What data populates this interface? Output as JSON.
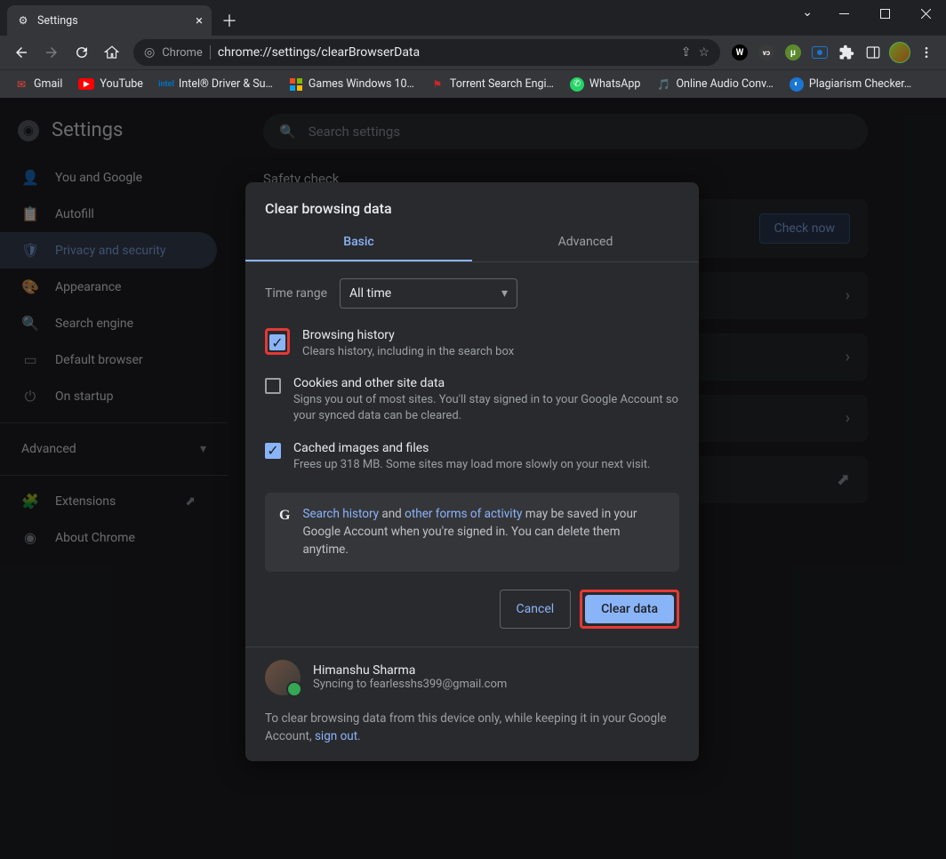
{
  "window": {
    "tab_title": "Settings"
  },
  "omnibox": {
    "label": "Chrome",
    "url": "chrome://settings/clearBrowserData"
  },
  "bookmarks": [
    {
      "label": "Gmail"
    },
    {
      "label": "YouTube"
    },
    {
      "label": "Intel® Driver & Su…"
    },
    {
      "label": "Games Windows 10…"
    },
    {
      "label": "Torrent Search Engi…"
    },
    {
      "label": "WhatsApp"
    },
    {
      "label": "Online Audio Conv…"
    },
    {
      "label": "Plagiarism Checker…"
    }
  ],
  "settings_title": "Settings",
  "search_placeholder": "Search settings",
  "sidebar": {
    "items": [
      {
        "label": "You and Google"
      },
      {
        "label": "Autofill"
      },
      {
        "label": "Privacy and security"
      },
      {
        "label": "Appearance"
      },
      {
        "label": "Search engine"
      },
      {
        "label": "Default browser"
      },
      {
        "label": "On startup"
      }
    ],
    "advanced": "Advanced",
    "extensions": "Extensions",
    "about": "About Chrome"
  },
  "main": {
    "safety_check": "Safety check",
    "check_now": "Check now"
  },
  "dialog": {
    "title": "Clear browsing data",
    "tabs": {
      "basic": "Basic",
      "advanced": "Advanced"
    },
    "time_range_label": "Time range",
    "time_range_value": "All time",
    "items": [
      {
        "title": "Browsing history",
        "sub": "Clears history, including in the search box"
      },
      {
        "title": "Cookies and other site data",
        "sub": "Signs you out of most sites. You'll stay signed in to your Google Account so your synced data can be cleared."
      },
      {
        "title": "Cached images and files",
        "sub": "Frees up 318 MB. Some sites may load more slowly on your next visit."
      }
    ],
    "info": {
      "pre": "",
      "link1": "Search history",
      "mid1": " and ",
      "link2": "other forms of activity",
      "mid2": " may be saved in your Google Account when you're signed in. You can delete them anytime."
    },
    "cancel": "Cancel",
    "clear": "Clear data",
    "user": {
      "name": "Himanshu Sharma",
      "sync": "Syncing to fearlesshs399@gmail.com"
    },
    "footer": {
      "pre": "To clear browsing data from this device only, while keeping it in your Google Account, ",
      "link": "sign out",
      "post": "."
    }
  }
}
